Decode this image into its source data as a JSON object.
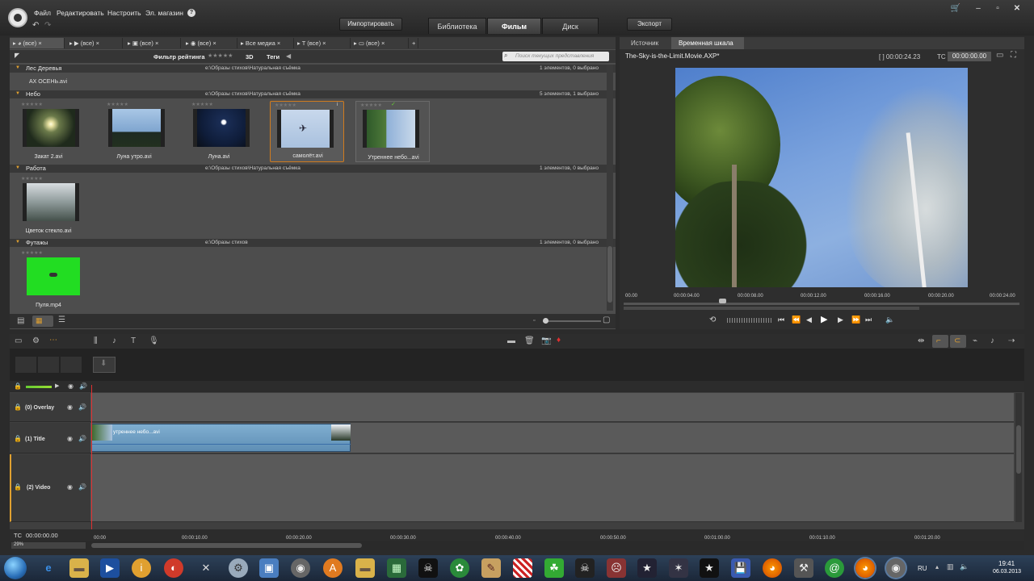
{
  "menu": {
    "file": "Файл",
    "edit": "Редактировать",
    "settings": "Настроить",
    "store": "Эл. магазин",
    "help": "?"
  },
  "header": {
    "import_button": "Импортировать",
    "export_button": "Экспорт",
    "tabs": [
      {
        "label": "Библиотека",
        "active": false
      },
      {
        "label": "Фильм",
        "active": true
      },
      {
        "label": "Диск",
        "active": false
      }
    ]
  },
  "library": {
    "tabs": [
      "(все)",
      "(все)",
      "(все)",
      "(все)",
      "Все медиа",
      "(все)",
      "(все)"
    ],
    "filter_label": "Фильтр рейтинга",
    "rating_stars": "★★★★★",
    "three_d": "3D",
    "tags": "Теги",
    "search_placeholder": "Поиск текущих представления",
    "groups": [
      {
        "name": "Лес Деревья",
        "path": "e:\\Образы стихов\\Натуральная съёмка",
        "count": "1 элементов, 0 выбрано",
        "items_text": "АХ ОСЕНЬ.avi"
      },
      {
        "name": "Небо",
        "path": "e:\\Образы стихов\\Натуральная съёмка",
        "count": "5 элементов, 1 выбрано",
        "items": [
          "Закат 2.avi",
          "Луна утро.avi",
          "Луна.avi",
          "самолёт.avi",
          "Утреннее небо...avi"
        ]
      },
      {
        "name": "Работа",
        "path": "e:\\Образы стихов\\Натуральная съёмка",
        "count": "1 элементов, 0 выбрано",
        "items": [
          "Цветок стекло.avi"
        ]
      },
      {
        "name": "Футажы",
        "path": "e:\\Образы стихов",
        "count": "1 элементов, 0 выбрано",
        "items": [
          "Пуля.mp4"
        ]
      }
    ]
  },
  "preview": {
    "tabs": [
      "Источник",
      "Временная шкала"
    ],
    "project_title": "The-Sky-is-the-Limit.Movie.AXP*",
    "duration": "[ ] 00:00:24.23",
    "tc_label": "TC",
    "tc_value": "00:00:00.00",
    "ruler": [
      "00.00",
      "00:00:04.00",
      "00:00:08.00",
      "00:00:12.00",
      "00:00:16.00",
      "00:00:20.00",
      "00:00:24.00"
    ]
  },
  "timeline": {
    "tracks": [
      {
        "name": "(0) Overlay"
      },
      {
        "name": "(1) Title"
      },
      {
        "name": "(2) Video"
      }
    ],
    "clip_label": "утреннее небо...avi",
    "tc_label": "TC",
    "tc_value": "00:00:00.00",
    "zoom": "29%",
    "ruler": [
      "00:00",
      "00:00:10.00",
      "00:00:20.00",
      "00:00:30.00",
      "00:00:40.00",
      "00:00:50.00",
      "00:01:00.00",
      "00:01:10.00",
      "00:01:20.00"
    ]
  },
  "tray": {
    "lang": "RU",
    "time": "19:41",
    "date": "06.03.2013"
  },
  "colors": {
    "accent": "#e0a030",
    "selection": "#d07b1e",
    "clip": "#6f9cc0",
    "playhead": "#e03030"
  }
}
